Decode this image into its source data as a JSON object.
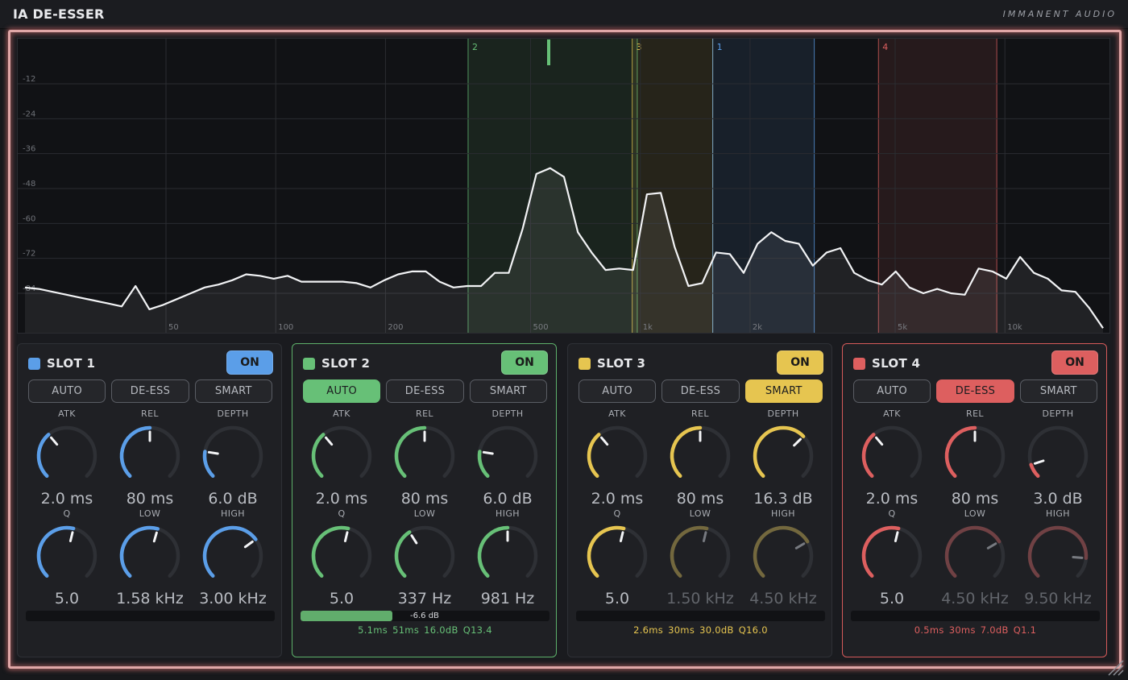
{
  "app": {
    "title": "IA DE-ESSER",
    "brand": "IMMANENT AUDIO"
  },
  "colors": {
    "slot1": "#5b9ee8",
    "slot2": "#67c077",
    "slot3": "#e6c550",
    "slot4": "#dd5f5f",
    "frame_glow": "#e0a7a7"
  },
  "spectrum": {
    "db_labels": [
      "-12",
      "-24",
      "-36",
      "-48",
      "-60",
      "-72",
      "-84"
    ],
    "freq_labels": [
      "50",
      "100",
      "200",
      "500",
      "1k",
      "2k",
      "5k",
      "10k"
    ],
    "bands": [
      {
        "label": "2",
        "slot": 2,
        "color": "#67c077",
        "low_hz": 337,
        "high_hz": 981
      },
      {
        "label": "3",
        "slot": 3,
        "color": "#e6c550",
        "low_hz": 950,
        "high_hz": 1580
      },
      {
        "label": "1",
        "slot": 1,
        "color": "#5b9ee8",
        "low_hz": 1580,
        "high_hz": 3000
      },
      {
        "label": "4",
        "slot": 4,
        "color": "#dd5f5f",
        "low_hz": 4500,
        "high_hz": 9500
      }
    ],
    "curve_db": [
      -82,
      -82.5,
      -83.5,
      -84.5,
      -85.5,
      -86.5,
      -87.5,
      -88.5,
      -81.5,
      -89.5,
      -88,
      -86,
      -84,
      -82,
      -81,
      -79.5,
      -77.5,
      -78,
      -79,
      -78,
      -80,
      -80,
      -80,
      -80,
      -80.5,
      -82,
      -79.5,
      -77.5,
      -76.5,
      -76.5,
      -80,
      -82,
      -81.5,
      -81.5,
      -77,
      -77,
      -62,
      -43,
      -41,
      -44,
      -63,
      -70,
      -76,
      -75.5,
      -76,
      -50,
      -49.5,
      -68,
      -81.5,
      -80.5,
      -70,
      -70.5,
      -77,
      -67,
      -63,
      -66,
      -67,
      -74.5,
      -70,
      -68.5,
      -77,
      -79.5,
      -81,
      -76.5,
      -82,
      -84,
      -82.5,
      -84,
      -84.5,
      -75.5,
      -76.5,
      -79,
      -71.5,
      -77,
      -79,
      -83,
      -83.5,
      -89,
      -96
    ],
    "curve_hz": [
      22,
      25,
      28,
      31,
      34,
      37,
      40,
      43,
      45,
      48,
      51,
      55,
      59,
      63,
      67,
      72,
      78,
      84,
      90,
      96,
      103,
      110,
      118,
      127,
      136,
      146,
      157,
      168,
      180,
      193,
      207,
      222,
      238,
      255,
      273,
      292,
      313,
      335,
      358,
      383,
      410,
      439,
      470,
      503,
      538,
      576,
      616,
      659,
      705,
      754,
      807,
      863,
      923,
      987,
      1055,
      1128,
      1207,
      1291,
      1381,
      1477,
      1580,
      1690,
      1807,
      1933,
      2068,
      2212,
      2366,
      2531,
      2707,
      2896,
      3097,
      3313,
      3544,
      3791,
      4055,
      4337,
      4640,
      4963,
      5308
    ]
  },
  "slots": [
    {
      "name": "SLOT 1",
      "on_label": "ON",
      "active_mode": "",
      "modes": [
        "AUTO",
        "DE-ESS",
        "SMART"
      ],
      "knobs": [
        {
          "label": "ATK",
          "value": "2.0 ms",
          "level": 0.35,
          "dim": false
        },
        {
          "label": "REL",
          "value": "80 ms",
          "level": 0.5,
          "dim": false
        },
        {
          "label": "DEPTH",
          "value": "6.0 dB",
          "level": 0.2,
          "dim": false
        },
        {
          "label": "Q",
          "value": "5.0",
          "level": 0.55,
          "dim": false
        },
        {
          "label": "LOW",
          "value": "1.58 kHz",
          "level": 0.56,
          "dim": false
        },
        {
          "label": "HIGH",
          "value": "3.00 kHz",
          "level": 0.7,
          "dim": false
        }
      ],
      "meter": {
        "level": 0,
        "text": ""
      },
      "stats": []
    },
    {
      "name": "SLOT 2",
      "on_label": "ON",
      "active_mode": "AUTO",
      "modes": [
        "AUTO",
        "DE-ESS",
        "SMART"
      ],
      "knobs": [
        {
          "label": "ATK",
          "value": "2.0 ms",
          "level": 0.35,
          "dim": false
        },
        {
          "label": "REL",
          "value": "80 ms",
          "level": 0.5,
          "dim": false
        },
        {
          "label": "DEPTH",
          "value": "6.0 dB",
          "level": 0.2,
          "dim": false
        },
        {
          "label": "Q",
          "value": "5.0",
          "level": 0.55,
          "dim": false
        },
        {
          "label": "LOW",
          "value": "337 Hz",
          "level": 0.38,
          "dim": false
        },
        {
          "label": "HIGH",
          "value": "981 Hz",
          "level": 0.5,
          "dim": false
        }
      ],
      "meter": {
        "level": 0.37,
        "text": "-6.6 dB"
      },
      "stats": [
        "5.1ms",
        "51ms",
        "16.0dB",
        "Q13.4"
      ]
    },
    {
      "name": "SLOT 3",
      "on_label": "ON",
      "active_mode": "SMART",
      "modes": [
        "AUTO",
        "DE-ESS",
        "SMART"
      ],
      "knobs": [
        {
          "label": "ATK",
          "value": "2.0 ms",
          "level": 0.35,
          "dim": false
        },
        {
          "label": "REL",
          "value": "80 ms",
          "level": 0.5,
          "dim": false
        },
        {
          "label": "DEPTH",
          "value": "16.3 dB",
          "level": 0.67,
          "dim": false
        },
        {
          "label": "Q",
          "value": "5.0",
          "level": 0.55,
          "dim": false
        },
        {
          "label": "LOW",
          "value": "1.50 kHz",
          "level": 0.55,
          "dim": true
        },
        {
          "label": "HIGH",
          "value": "4.50 kHz",
          "level": 0.72,
          "dim": true
        }
      ],
      "meter": {
        "level": 0,
        "text": ""
      },
      "stats": [
        "2.6ms",
        "30ms",
        "30.0dB",
        "Q16.0"
      ]
    },
    {
      "name": "SLOT 4",
      "on_label": "ON",
      "active_mode": "DE-ESS",
      "modes": [
        "AUTO",
        "DE-ESS",
        "SMART"
      ],
      "knobs": [
        {
          "label": "ATK",
          "value": "2.0 ms",
          "level": 0.35,
          "dim": false
        },
        {
          "label": "REL",
          "value": "80 ms",
          "level": 0.5,
          "dim": false
        },
        {
          "label": "DEPTH",
          "value": "3.0 dB",
          "level": 0.1,
          "dim": false
        },
        {
          "label": "Q",
          "value": "5.0",
          "level": 0.55,
          "dim": false
        },
        {
          "label": "LOW",
          "value": "4.50 kHz",
          "level": 0.72,
          "dim": true
        },
        {
          "label": "HIGH",
          "value": "9.50 kHz",
          "level": 0.85,
          "dim": true
        }
      ],
      "meter": {
        "level": 0,
        "text": ""
      },
      "stats": [
        "0.5ms",
        "30ms",
        "7.0dB",
        "Q1.1"
      ]
    }
  ]
}
